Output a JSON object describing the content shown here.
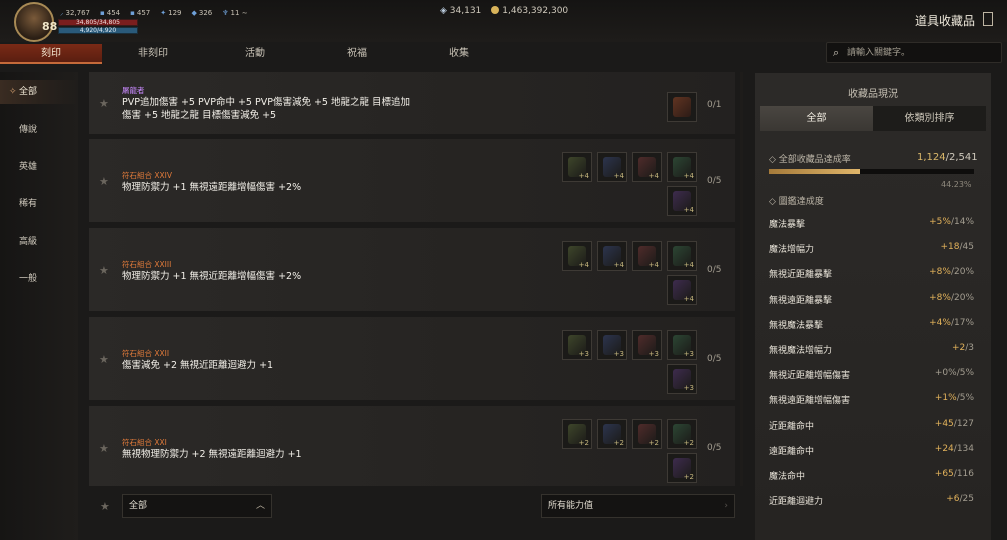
{
  "player": {
    "level": "88",
    "stat1": "32,767",
    "stat2": "454",
    "stat3": "457",
    "stat4": "129",
    "stat5": "326",
    "stat6": "11",
    "hp": "34,805/34,805",
    "mp": "4,920/4,920"
  },
  "currency": {
    "diamond": "34,131",
    "gold": "1,463,392,300"
  },
  "header": {
    "title": "道具收藏品"
  },
  "tabs": [
    {
      "label": "刻印"
    },
    {
      "label": "非刻印"
    },
    {
      "label": "活動"
    },
    {
      "label": "祝福"
    },
    {
      "label": "收集"
    }
  ],
  "search": {
    "placeholder": "請輸入關鍵字。"
  },
  "sidebar": {
    "items": [
      {
        "label": "全部"
      },
      {
        "label": "傳說"
      },
      {
        "label": "英雄"
      },
      {
        "label": "稀有"
      },
      {
        "label": "高級"
      },
      {
        "label": "一般"
      }
    ]
  },
  "list": {
    "rows": [
      {
        "category": "屠龍者",
        "line1": "PVP追加傷害 +5 PVP命中 +5 PVP傷害減免 +5 地龍之龍 目標追加",
        "line2": "傷害 +5 地龍之龍 目標傷害減免 +5",
        "count": "0/1"
      },
      {
        "category": "符石組合 XXIV",
        "line1": "物理防禦力 +1 無視遠距離增幅傷害 +2%",
        "line2": "",
        "count": "0/5",
        "plus": "+4"
      },
      {
        "category": "符石組合 XXIII",
        "line1": "物理防禦力 +1 無視近距離增幅傷害 +2%",
        "line2": "",
        "count": "0/5",
        "plus": "+4"
      },
      {
        "category": "符石組合 XXII",
        "line1": "傷害減免 +2 無視近距離迴避力 +1",
        "line2": "",
        "count": "0/5",
        "plus": "+3"
      },
      {
        "category": "符石組合 XXI",
        "line1": "無視物理防禦力 +2 無視遠距離迴避力 +1",
        "line2": "",
        "count": "0/5",
        "plus": "+2"
      }
    ]
  },
  "filters": {
    "grade": "全部",
    "ability": "所有能力值"
  },
  "panel": {
    "title": "收藏品現況",
    "tab_all": "全部",
    "tab_sort": "依類別排序",
    "rate_label": "◇ 全部收藏品達成率",
    "rate_current": "1,124",
    "rate_total": "/2,541",
    "rate_fraction": 0.4423,
    "rate_pct": "44.23%",
    "section_label": "◇ 圖鑑達成度",
    "stats": [
      {
        "name": "魔法暴擊",
        "cur": "+5%",
        "max": "/14%",
        "dim": false
      },
      {
        "name": "魔法增幅力",
        "cur": "+18",
        "max": "/45",
        "dim": false
      },
      {
        "name": "無視近距離暴擊",
        "cur": "+8%",
        "max": "/20%",
        "dim": false
      },
      {
        "name": "無視遠距離暴擊",
        "cur": "+8%",
        "max": "/20%",
        "dim": false
      },
      {
        "name": "無視魔法暴擊",
        "cur": "+4%",
        "max": "/17%",
        "dim": false
      },
      {
        "name": "無視魔法增幅力",
        "cur": "+2",
        "max": "/3",
        "dim": false
      },
      {
        "name": "無視近距離增幅傷害",
        "cur": "+0%",
        "max": "/5%",
        "dim": true
      },
      {
        "name": "無視遠距離增幅傷害",
        "cur": "+1%",
        "max": "/5%",
        "dim": false
      },
      {
        "name": "近距離命中",
        "cur": "+45",
        "max": "/127",
        "dim": false
      },
      {
        "name": "遠距離命中",
        "cur": "+24",
        "max": "/134",
        "dim": false
      },
      {
        "name": "魔法命中",
        "cur": "+65",
        "max": "/116",
        "dim": false
      },
      {
        "name": "近距離迴避力",
        "cur": "+6",
        "max": "/25",
        "dim": false
      }
    ]
  },
  "colors": {
    "accent": "#7a2a16",
    "gold": "#e2b25b",
    "category_legend": "#c98aff",
    "category_rune": "#e07a3a"
  }
}
